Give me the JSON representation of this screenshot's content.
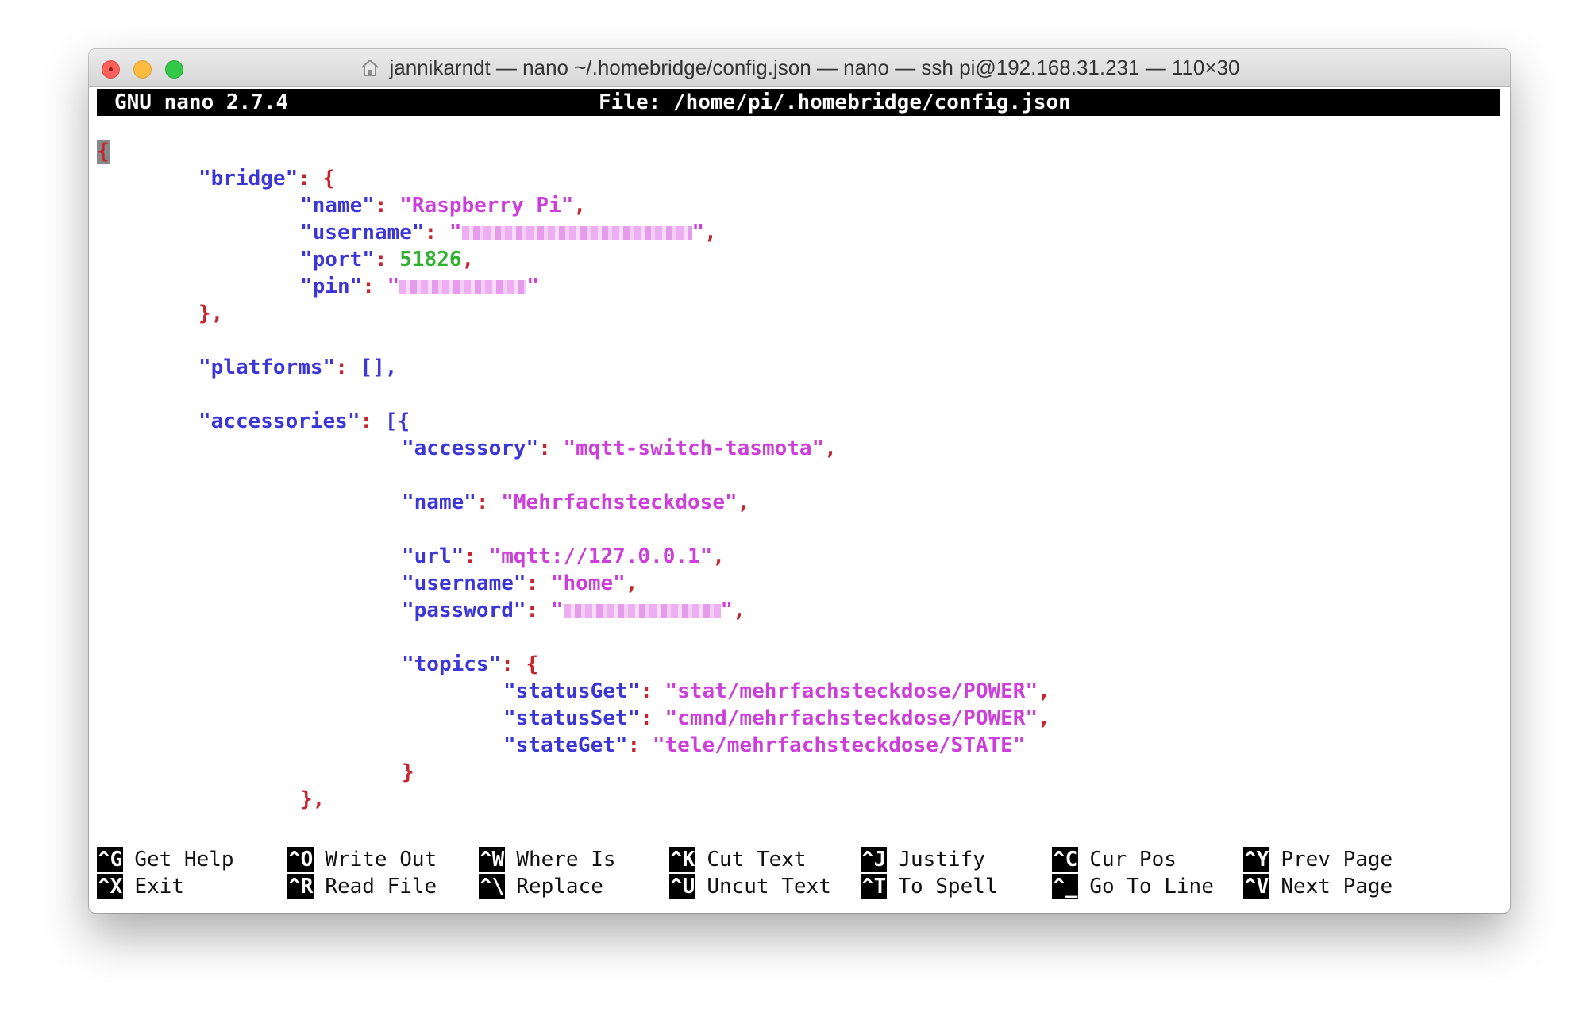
{
  "window": {
    "title": "jannikarndt — nano ~/.homebridge/config.json — nano — ssh pi@192.168.31.231 — 110×30",
    "home_icon": "house-icon"
  },
  "header": {
    "version": "GNU nano 2.7.4",
    "file": "File: /home/pi/.homebridge/config.json"
  },
  "editor": {
    "open_brace": "{",
    "bridge_key": "\"bridge\"",
    "name_key": "\"name\"",
    "name_value": "\"Raspberry Pi\"",
    "username_key": "\"username\"",
    "port_key": "\"port\"",
    "port_value": "51826",
    "pin_key": "\"pin\"",
    "close_bridge": "},",
    "platforms_key": "\"platforms\"",
    "platforms_value": "[],",
    "accessories_key": "\"accessories\"",
    "accessories_open": "[{",
    "accessory_key": "\"accessory\"",
    "accessory_value": "\"mqtt-switch-tasmota\"",
    "acc_name_key": "\"name\"",
    "acc_name_value": "\"Mehrfachsteckdose\"",
    "url_key": "\"url\"",
    "url_value": "\"mqtt://127.0.0.1\"",
    "acc_username_key": "\"username\"",
    "acc_username_value": "\"home\"",
    "password_key": "\"password\"",
    "topics_key": "\"topics\"",
    "statusget_key": "\"statusGet\"",
    "statusget_value": "\"stat/mehrfachsteckdose/POWER\"",
    "statusset_key": "\"statusSet\"",
    "statusset_value": "\"cmnd/mehrfachsteckdose/POWER\"",
    "stateget_key": "\"stateGet\"",
    "stateget_value": "\"tele/mehrfachsteckdose/STATE\"",
    "close_topics": "}",
    "close_accessory": "},"
  },
  "shortcuts": [
    {
      "key": "^G",
      "label": "Get Help"
    },
    {
      "key": "^X",
      "label": "Exit"
    },
    {
      "key": "^O",
      "label": "Write Out"
    },
    {
      "key": "^R",
      "label": "Read File"
    },
    {
      "key": "^W",
      "label": "Where Is"
    },
    {
      "key": "^\\",
      "label": "Replace"
    },
    {
      "key": "^K",
      "label": "Cut Text"
    },
    {
      "key": "^U",
      "label": "Uncut Text"
    },
    {
      "key": "^J",
      "label": "Justify"
    },
    {
      "key": "^T",
      "label": "To Spell"
    },
    {
      "key": "^C",
      "label": "Cur Pos"
    },
    {
      "key": "^_",
      "label": "Go To Line"
    },
    {
      "key": "^Y",
      "label": "Prev Page"
    },
    {
      "key": "^V",
      "label": "Next Page"
    }
  ],
  "colors": {
    "key": "#3c36d6",
    "string": "#cc3fd8",
    "number": "#2fb02f",
    "punctuation": "#c4262e"
  }
}
